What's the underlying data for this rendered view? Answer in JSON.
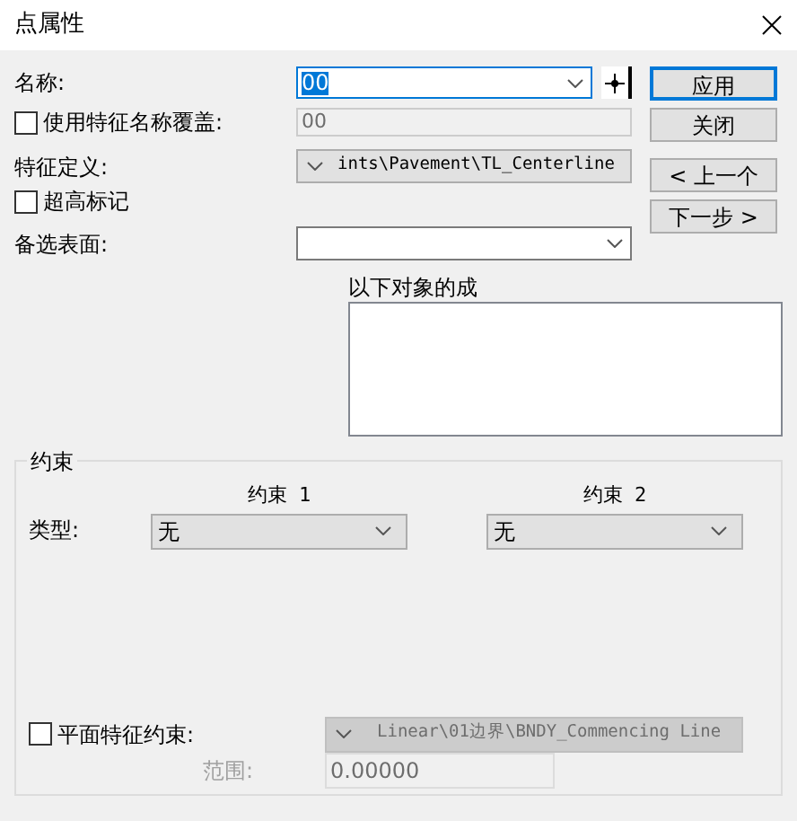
{
  "window": {
    "title": "点属性"
  },
  "name": {
    "label": "名称:",
    "value": "00",
    "text_selected": true
  },
  "override": {
    "label": "使用特征名称覆盖:",
    "checked": false,
    "value": "00"
  },
  "feature_definition": {
    "label": "特征定义:",
    "value": "ints\\Pavement\\TL_Centerline"
  },
  "superelevation": {
    "label": "超高标记",
    "checked": false
  },
  "alt_surface": {
    "label": "备选表面:"
  },
  "list": {
    "label": "以下对象的成"
  },
  "buttons": [
    {
      "label": "应用",
      "default": true
    },
    {
      "label": "关闭",
      "default": false
    },
    {
      "label": "< 上一个",
      "default": false
    },
    {
      "label": "下一步 >",
      "default": false
    }
  ],
  "constraints": {
    "title": "约束",
    "type_label": "类型:",
    "columns": [
      {
        "heading": "约束 1",
        "value": "无"
      },
      {
        "heading": "约束 2",
        "value": "无"
      }
    ],
    "plan": {
      "label": "平面特征约束:",
      "checked": false,
      "value": "Linear\\01边界\\BNDY_Commencing Line"
    },
    "range": {
      "label": "范围:",
      "value": "0.00000",
      "disabled": true
    }
  }
}
